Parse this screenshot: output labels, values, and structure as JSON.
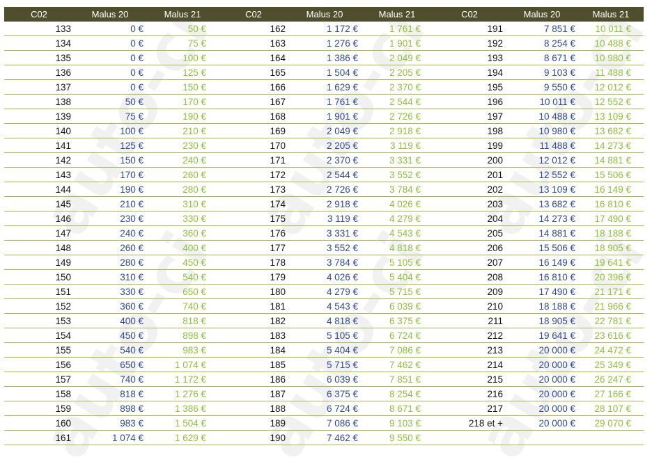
{
  "watermark": "auto-ci",
  "headers": [
    "C02",
    "Malus 20",
    "Malus 21",
    "C02",
    "Malus 20",
    "Malus 21",
    "C02",
    "Malus 20",
    "Malus 21"
  ],
  "rows": [
    [
      "133",
      "0 €",
      "50 €",
      "162",
      "1 172 €",
      "1 761 €",
      "191",
      "7 851 €",
      "10 011 €"
    ],
    [
      "134",
      "0 €",
      "75 €",
      "163",
      "1 276 €",
      "1 901 €",
      "192",
      "8 254 €",
      "10 488 €"
    ],
    [
      "135",
      "0 €",
      "100 €",
      "164",
      "1 386 €",
      "2 049 €",
      "193",
      "8 671 €",
      "10 980 €"
    ],
    [
      "136",
      "0 €",
      "125 €",
      "165",
      "1 504 €",
      "2 205 €",
      "194",
      "9 103 €",
      "11 488 €"
    ],
    [
      "137",
      "0 €",
      "150 €",
      "166",
      "1 629 €",
      "2 370 €",
      "195",
      "9 550 €",
      "12 012 €"
    ],
    [
      "138",
      "50 €",
      "170 €",
      "167",
      "1 761 €",
      "2 544 €",
      "196",
      "10 011 €",
      "12 552 €"
    ],
    [
      "139",
      "75 €",
      "190 €",
      "168",
      "1 901 €",
      "2 726 €",
      "197",
      "10 488 €",
      "13 109 €"
    ],
    [
      "140",
      "100 €",
      "210 €",
      "169",
      "2 049 €",
      "2 918 €",
      "198",
      "10 980 €",
      "13 682 €"
    ],
    [
      "141",
      "125 €",
      "230 €",
      "170",
      "2 205 €",
      "3 119 €",
      "199",
      "11 488 €",
      "14 273 €"
    ],
    [
      "142",
      "150 €",
      "240 €",
      "171",
      "2 370 €",
      "3 331 €",
      "200",
      "12 012 €",
      "14 881 €"
    ],
    [
      "143",
      "170 €",
      "260 €",
      "172",
      "2 544 €",
      "3 552 €",
      "201",
      "12 552 €",
      "15 506 €"
    ],
    [
      "144",
      "190 €",
      "280 €",
      "173",
      "2 726 €",
      "3 784 €",
      "202",
      "13 109 €",
      "16 149 €"
    ],
    [
      "145",
      "210 €",
      "310 €",
      "174",
      "2 918 €",
      "4 026 €",
      "203",
      "13 682 €",
      "16 810 €"
    ],
    [
      "146",
      "230 €",
      "330 €",
      "175",
      "3 119 €",
      "4 279 €",
      "204",
      "14 273 €",
      "17 490 €"
    ],
    [
      "147",
      "240 €",
      "360 €",
      "176",
      "3 331 €",
      "4 543 €",
      "205",
      "14 881 €",
      "18 188 €"
    ],
    [
      "148",
      "260 €",
      "400 €",
      "177",
      "3 552 €",
      "4 818 €",
      "206",
      "15 506 €",
      "18 905 €"
    ],
    [
      "149",
      "280 €",
      "450 €",
      "178",
      "3 784 €",
      "5 105 €",
      "207",
      "16 149 €",
      "19 641 €"
    ],
    [
      "150",
      "310 €",
      "540 €",
      "179",
      "4 026 €",
      "5 404 €",
      "208",
      "16 810 €",
      "20 396 €"
    ],
    [
      "151",
      "330 €",
      "650 €",
      "180",
      "4 279 €",
      "5 715 €",
      "209",
      "17 490 €",
      "21 171 €"
    ],
    [
      "152",
      "360 €",
      "740 €",
      "181",
      "4 543 €",
      "6 039 €",
      "210",
      "18 188 €",
      "21 966 €"
    ],
    [
      "153",
      "400 €",
      "818 €",
      "182",
      "4 818 €",
      "6 375 €",
      "211",
      "18 905 €",
      "22 781 €"
    ],
    [
      "154",
      "450 €",
      "898 €",
      "183",
      "5 105 €",
      "6 724 €",
      "212",
      "19 641 €",
      "23 616 €"
    ],
    [
      "155",
      "540 €",
      "983 €",
      "184",
      "5 404 €",
      "7 086 €",
      "213",
      "20 000 €",
      "24 472 €"
    ],
    [
      "156",
      "650 €",
      "1 074 €",
      "185",
      "5 715 €",
      "7 462 €",
      "214",
      "20 000 €",
      "25 349 €"
    ],
    [
      "157",
      "740 €",
      "1 172 €",
      "186",
      "6 039 €",
      "7 851 €",
      "215",
      "20 000 €",
      "26 247 €"
    ],
    [
      "158",
      "818 €",
      "1 276 €",
      "187",
      "6 375 €",
      "8 254 €",
      "216",
      "20 000 €",
      "27 166 €"
    ],
    [
      "159",
      "898 €",
      "1 386 €",
      "188",
      "6 724 €",
      "8 671 €",
      "217",
      "20 000 €",
      "28 107 €"
    ],
    [
      "160",
      "983 €",
      "1 504 €",
      "189",
      "7 086 €",
      "9 103 €",
      "218 et +",
      "20 000 €",
      "29 070 €"
    ],
    [
      "161",
      "1 074 €",
      "1 629 €",
      "190",
      "7 462 €",
      "9 550 €",
      "",
      "",
      ""
    ]
  ]
}
